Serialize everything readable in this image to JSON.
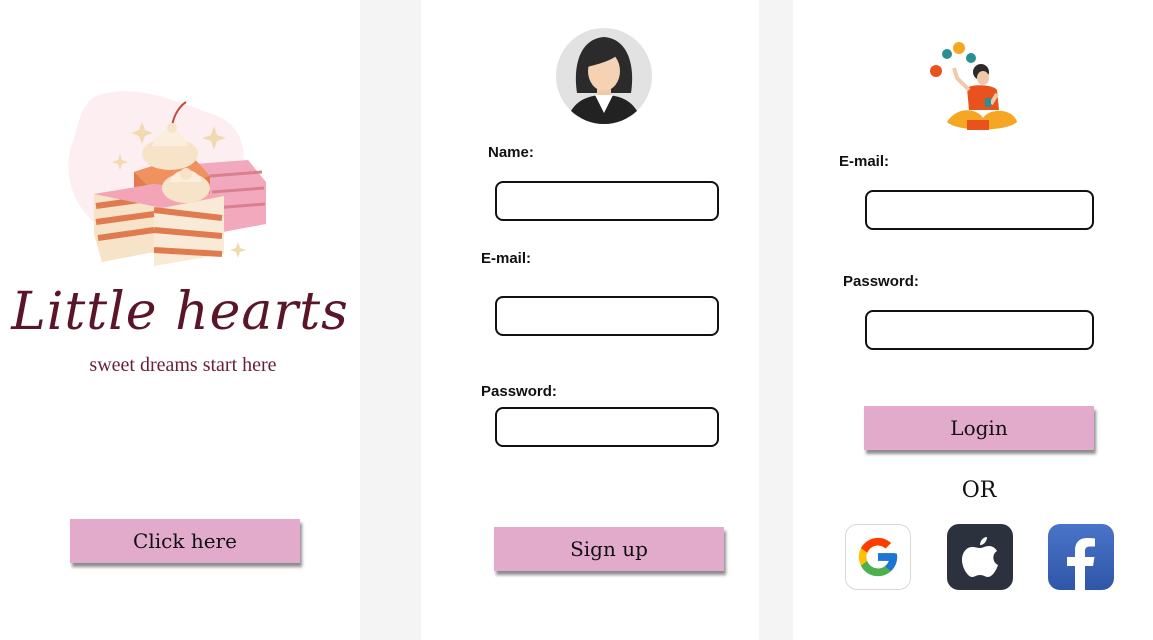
{
  "splash": {
    "brand_name": "Little hearts",
    "tagline": "sweet dreams start here",
    "cta_label": "Click here"
  },
  "signup": {
    "name_label": "Name:",
    "email_label": "E-mail:",
    "password_label": "Password:",
    "submit_label": "Sign up"
  },
  "login": {
    "email_label": "E-mail:",
    "password_label": "Password:",
    "submit_label": "Login",
    "separator": "OR",
    "social": [
      "google-icon",
      "apple-icon",
      "facebook-icon"
    ]
  },
  "colors": {
    "accent_button": "#e2aacb",
    "brand_text": "#5a1628",
    "background_gutter": "#f4f4f4"
  }
}
